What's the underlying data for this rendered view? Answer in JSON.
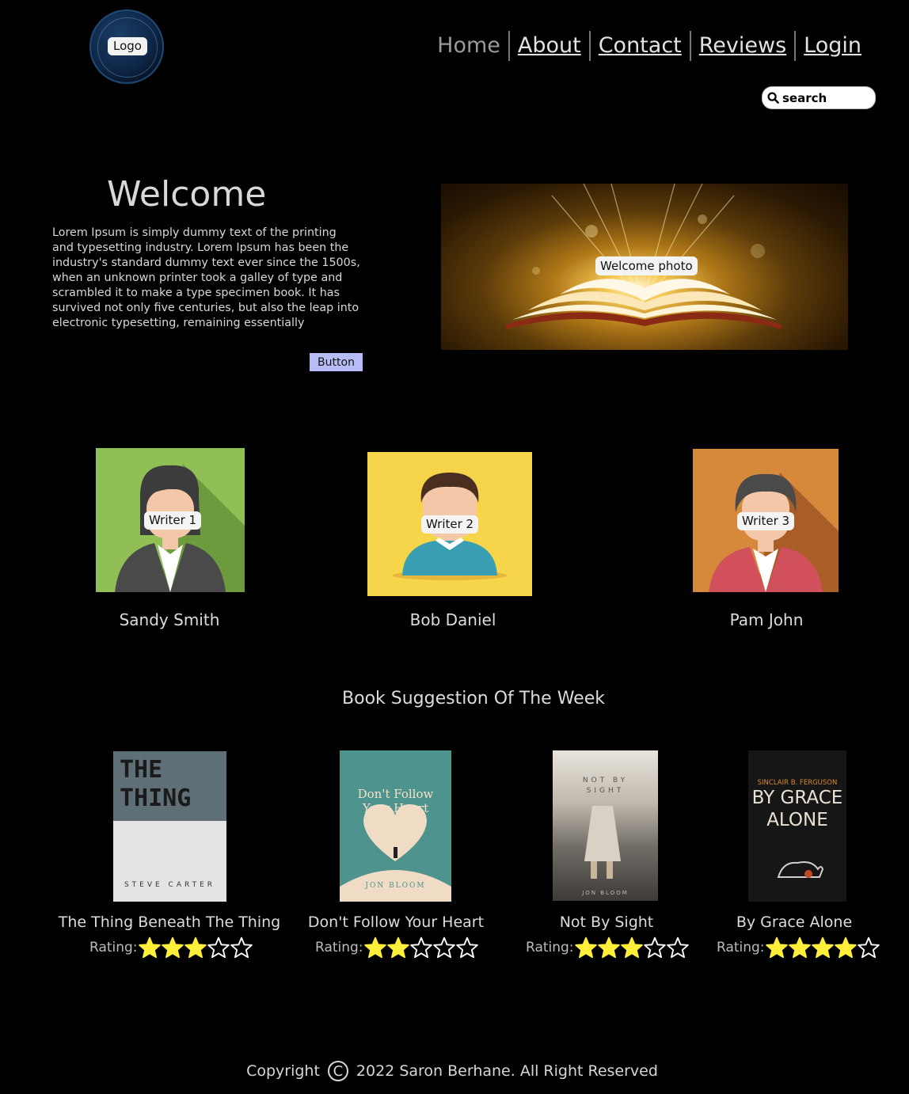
{
  "header": {
    "logo_label": "Logo",
    "nav": [
      "Home",
      "About",
      "Contact",
      "Reviews",
      "Login"
    ],
    "search_placeholder": "search"
  },
  "welcome": {
    "title": "Welcome",
    "text": "Lorem Ipsum is simply dummy text of the printing and typesetting industry. Lorem Ipsum has been the industry's standard dummy text ever since the 1500s, when an unknown printer took a galley of type and scrambled it to make a type specimen book. It has survived not only five centuries, but also the leap into electronic typesetting, remaining essentially",
    "button_label": "Button",
    "photo_label": "Welcome photo"
  },
  "writers": [
    {
      "label": "Writer 1",
      "name": "Sandy Smith",
      "bg": "#8fbf55"
    },
    {
      "label": "Writer 2",
      "name": "Bob Daniel",
      "bg": "#f6d54a"
    },
    {
      "label": "Writer 3",
      "name": "Pam John",
      "bg": "#d7893b"
    }
  ],
  "books_section": {
    "title": "Book Suggestion Of The Week",
    "rating_label": "Rating:",
    "books": [
      {
        "title": "The Thing Beneath The Thing",
        "rating": 3,
        "cover_text": "THE THING",
        "cover_author": "STEVE CARTER"
      },
      {
        "title": "Don't Follow Your Heart",
        "rating": 2,
        "cover_text": "Don't Follow Your Heart",
        "cover_author": "JON BLOOM"
      },
      {
        "title": "Not By Sight",
        "rating": 3,
        "cover_text": "NOT BY SIGHT",
        "cover_author": "JON BLOOM"
      },
      {
        "title": "By Grace Alone",
        "rating": 4,
        "cover_text": "BY GRACE ALONE",
        "cover_author": "SINCLAIR B. FERGUSON"
      }
    ],
    "star_color": "#ffee3a"
  },
  "footer": {
    "left": "Copyright",
    "symbol": "C",
    "right": "2022 Saron Berhane. All Right Reserved"
  }
}
